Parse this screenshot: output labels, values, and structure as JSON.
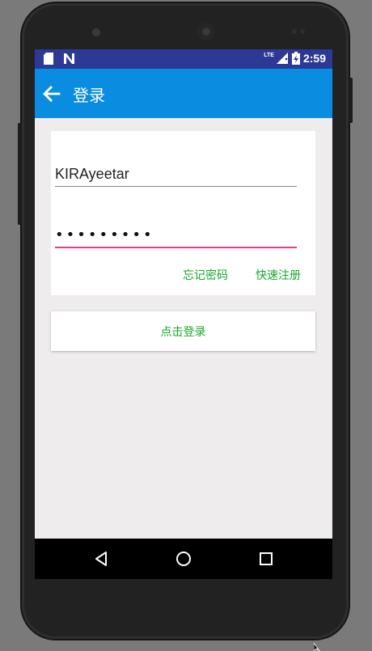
{
  "status_bar": {
    "time": "2:59",
    "network": "LTE",
    "icons": [
      "sd-card-icon",
      "n-notification-icon",
      "lte-signal-icon",
      "battery-charging-icon"
    ]
  },
  "toolbar": {
    "back_icon": "arrow-left-icon",
    "title": "登录",
    "color": "#0a8ce0"
  },
  "form": {
    "username_value": "KIRAyeetar",
    "password_value": "•••••••••",
    "forgot_password": "忘记密码",
    "quick_register": "快速注册",
    "accent_color": "#e53e82",
    "link_color": "#16a82a"
  },
  "login_button": {
    "label": "点击登录"
  },
  "nav_bar": {
    "back": "triangle-back-icon",
    "home": "circle-home-icon",
    "recents": "square-recents-icon"
  }
}
